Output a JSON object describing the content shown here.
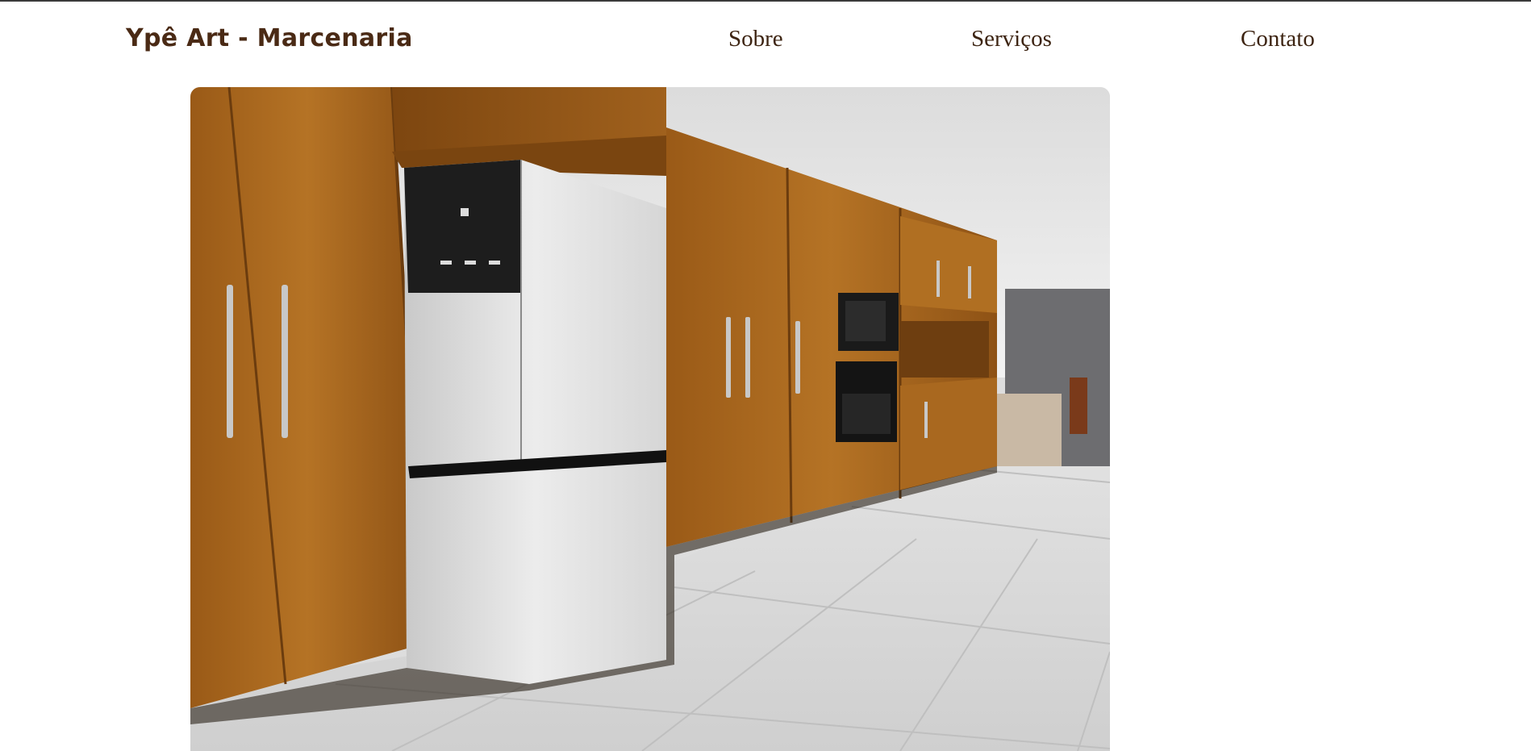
{
  "header": {
    "brand": "Ypê Art - Marcenaria",
    "nav": [
      {
        "label": "Sobre"
      },
      {
        "label": "Serviços"
      },
      {
        "label": "Contato"
      }
    ]
  },
  "hero_image": {
    "subject": "wood kitchen cabinets with white french-door refrigerator, built-in microwave and oven"
  },
  "colors": {
    "brand_text": "#4a2a15",
    "nav_text": "#3d2412",
    "wood": "#a8661c",
    "floor": "#d9d9d9"
  }
}
